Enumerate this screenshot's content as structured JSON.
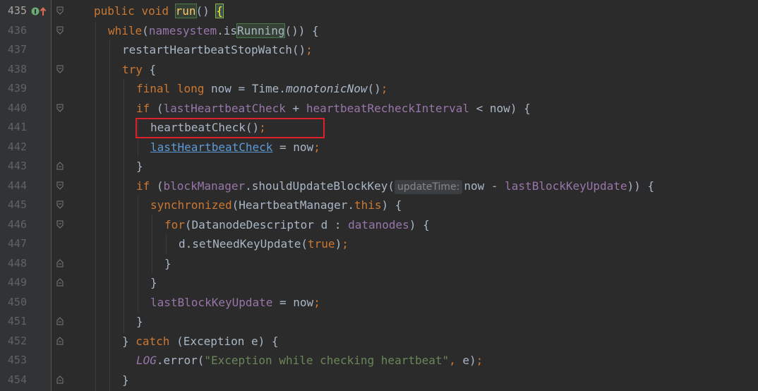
{
  "editor": {
    "lines": [
      {
        "num": "435",
        "current": true
      },
      {
        "num": "436"
      },
      {
        "num": "437"
      },
      {
        "num": "438"
      },
      {
        "num": "439"
      },
      {
        "num": "440"
      },
      {
        "num": "441"
      },
      {
        "num": "442"
      },
      {
        "num": "443"
      },
      {
        "num": "444"
      },
      {
        "num": "445"
      },
      {
        "num": "446"
      },
      {
        "num": "447"
      },
      {
        "num": "448"
      },
      {
        "num": "449"
      },
      {
        "num": "450"
      },
      {
        "num": "451"
      },
      {
        "num": "452"
      },
      {
        "num": "453"
      },
      {
        "num": "454"
      }
    ],
    "code": {
      "l435": {
        "kw_public": "public",
        "kw_void": "void",
        "method": "run",
        "paren": "() ",
        "brace": "{"
      },
      "l436": {
        "kw": "while",
        "open": "(",
        "field": "namesystem",
        "dot": ".is",
        "running_hl": "Running",
        "rest": "()) {"
      },
      "l437": {
        "text": "restartHeartbeatStopWatch()",
        "semi": ";"
      },
      "l438": {
        "kw": "try",
        "rest": " {"
      },
      "l439": {
        "kw_final": "final",
        "kw_long": "long",
        "mid": " now = Time.",
        "ital": "monotonicNow",
        "end": "()",
        "semi": ";"
      },
      "l440": {
        "kw": "if",
        "open": " (",
        "f1": "lastHeartbeatCheck",
        "plus": " + ",
        "f2": "heartbeatRecheckInterval",
        "rest": " < now) {"
      },
      "l441": {
        "text": "heartbeatCheck()",
        "semi": ";"
      },
      "l442": {
        "link": "lastHeartbeatCheck",
        "rest": " = now",
        "semi": ";"
      },
      "l443": {
        "text": "}"
      },
      "l444": {
        "kw": "if",
        "open": " (",
        "field": "blockManager",
        "call": ".shouldUpdateBlockKey(",
        "hint": "updateTime:",
        "mid": "now - ",
        "f2": "lastBlockKeyUpdate",
        "rest": ")) {"
      },
      "l445": {
        "kw": "synchronized",
        "mid": "(HeartbeatManager.",
        "kw_this": "this",
        "rest": ") {"
      },
      "l446": {
        "kw": "for",
        "mid": "(DatanodeDescriptor d : ",
        "field": "datanodes",
        "rest": ") {"
      },
      "l447": {
        "pre": "d.setNeedKeyUpdate(",
        "kw_true": "true",
        "end": ")",
        "semi": ";"
      },
      "l448": {
        "text": "}"
      },
      "l449": {
        "text": "}"
      },
      "l450": {
        "field": "lastBlockKeyUpdate",
        "rest": " = now",
        "semi": ";"
      },
      "l451": {
        "text": "}"
      },
      "l452": {
        "close": "} ",
        "kw": "catch",
        "rest": " (Exception e) {"
      },
      "l453": {
        "const": "LOG",
        "call": ".error(",
        "str": "\"Exception while checking heartbeat\"",
        "comma": ", ",
        "e": "e)",
        "semi": ";"
      },
      "l454": {
        "text": "}"
      }
    }
  },
  "colors": {
    "background": "#2b2b2b",
    "gutter": "#313335",
    "keyword": "#cc7832",
    "field": "#9876aa",
    "string": "#6a8759",
    "method_decl": "#ffc66d",
    "highlight_box": "#e0212b"
  },
  "icons": {
    "line_435_marker": "implementation-override-icon"
  }
}
